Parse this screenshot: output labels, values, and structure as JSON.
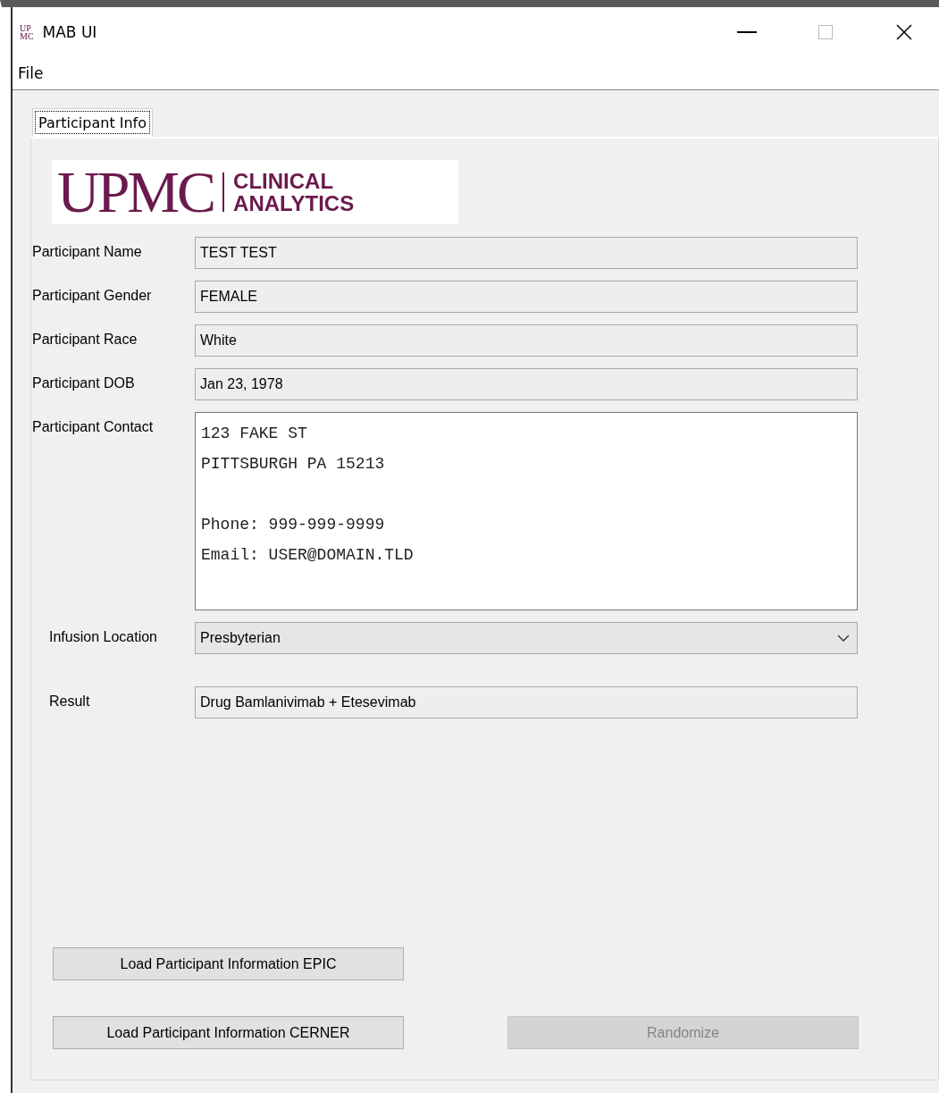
{
  "window": {
    "title": "MAB UI",
    "icon_lines": [
      "UP",
      "MC"
    ]
  },
  "menu": [
    {
      "label": "File"
    }
  ],
  "tabs": [
    {
      "label": "Participant Info",
      "selected": true
    }
  ],
  "logo": {
    "wordmark": "UPMC",
    "tagline": [
      "CLINICAL",
      "ANALYTICS"
    ]
  },
  "fields": [
    {
      "kind": "text",
      "label": "Participant Name",
      "value": "TEST TEST"
    },
    {
      "kind": "text",
      "label": "Participant Gender",
      "value": "FEMALE"
    },
    {
      "kind": "text",
      "label": "Participant Race",
      "value": "White"
    },
    {
      "kind": "text",
      "label": "Participant DOB",
      "value": "Jan 23, 1978"
    },
    {
      "kind": "textarea",
      "label": "Participant Contact",
      "paragraphs": [
        [
          "123 FAKE ST",
          "PITTSBURGH PA 15213"
        ],
        [
          "Phone: 999-999-9999",
          "Email: USER@DOMAIN.TLD"
        ]
      ]
    }
  ],
  "location": {
    "label": "Infusion Location",
    "value": "Presbyterian"
  },
  "result": {
    "label": "Result",
    "value": "Drug Bamlanivimab + Etesevimab"
  },
  "button_rows": [
    [
      {
        "label": "Load Participant Information EPIC",
        "disabled": false
      }
    ],
    [
      {
        "label": "Load Participant Information CERNER",
        "disabled": false
      },
      {
        "label": "Randomize",
        "disabled": true
      }
    ]
  ]
}
